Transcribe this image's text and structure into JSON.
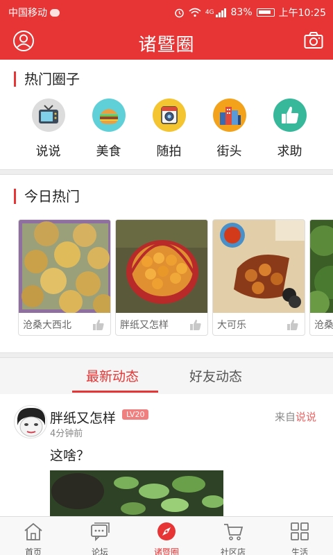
{
  "status_bar": {
    "carrier": "中国移动",
    "network": "4G",
    "battery": "83%",
    "time": "上午10:25"
  },
  "app_bar": {
    "title": "诸暨圈",
    "left_icon": "user-circle-icon",
    "right_icon": "camera-icon"
  },
  "hot_circles": {
    "title": "热门圈子",
    "items": [
      {
        "label": "说说",
        "icon": "tv-icon",
        "color": "#dcdcdc"
      },
      {
        "label": "美食",
        "icon": "burger-icon",
        "color": "#5fd0d8"
      },
      {
        "label": "随拍",
        "icon": "photo-camera-icon",
        "color": "#f4c431"
      },
      {
        "label": "街头",
        "icon": "city-icon",
        "color": "#f3a21c"
      },
      {
        "label": "求助",
        "icon": "thumbs-up-icon",
        "color": "#37b89a"
      }
    ]
  },
  "today_hot": {
    "title": "今日热门",
    "cards": [
      {
        "name": "沧桑大西北"
      },
      {
        "name": "胖纸又怎样"
      },
      {
        "name": "大可乐"
      },
      {
        "name": "沧桑"
      }
    ]
  },
  "tabs": [
    {
      "label": "最新动态",
      "active": true
    },
    {
      "label": "好友动态",
      "active": false
    }
  ],
  "post": {
    "user": "胖纸又怎样",
    "level": "LV20",
    "time": "4分钟前",
    "source_prefix": "来自",
    "source_link": "说说",
    "text": "这啥？"
  },
  "bottom_nav": [
    {
      "label": "首页",
      "icon": "home-icon",
      "active": false
    },
    {
      "label": "论坛",
      "icon": "chat-icon",
      "active": false
    },
    {
      "label": "诸暨圈",
      "icon": "compass-icon",
      "active": true
    },
    {
      "label": "社区店",
      "icon": "cart-icon",
      "active": false
    },
    {
      "label": "生活",
      "icon": "grid-icon",
      "active": false
    }
  ],
  "colors": {
    "primary": "#e73535",
    "level_badge": "#f08080"
  }
}
